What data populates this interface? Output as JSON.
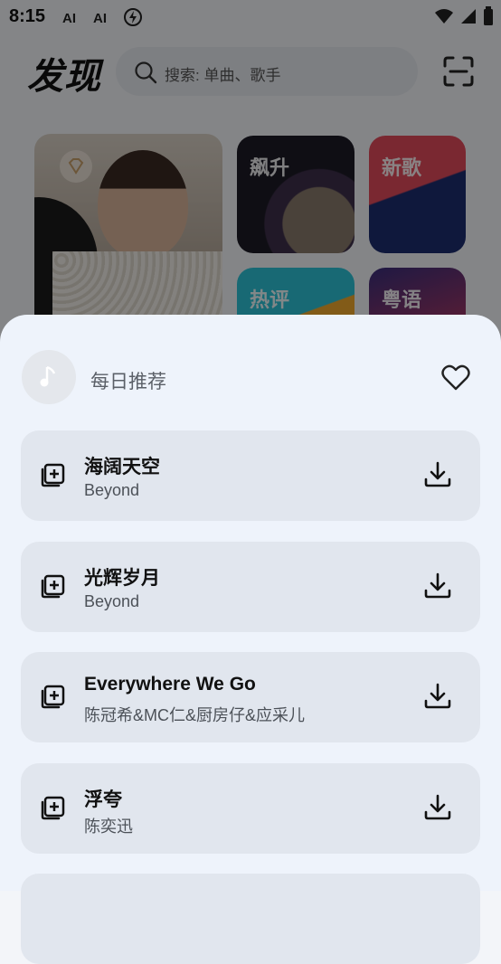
{
  "status_bar": {
    "time": "8:15",
    "icons": [
      "ai-icon",
      "ai-icon",
      "flash-icon",
      "wifi-icon",
      "signal-icon",
      "battery-icon"
    ]
  },
  "header": {
    "title": "发现",
    "search_placeholder": "搜索: 单曲、歌手"
  },
  "categories": [
    {
      "label": "飙升"
    },
    {
      "label": "新歌"
    },
    {
      "label": "热评"
    },
    {
      "label": "粤语"
    }
  ],
  "sheet": {
    "title": "每日推荐",
    "songs": [
      {
        "name": "海阔天空",
        "artist": "Beyond"
      },
      {
        "name": "光辉岁月",
        "artist": "Beyond"
      },
      {
        "name": "Everywhere We Go",
        "artist": "陈冠希&MC仁&厨房仔&应采儿"
      },
      {
        "name": "浮夸",
        "artist": "陈奕迅"
      }
    ]
  },
  "colors": {
    "sheet_bg": "#eef3fb",
    "row_bg": "#e1e6ee",
    "text": "#111111"
  }
}
